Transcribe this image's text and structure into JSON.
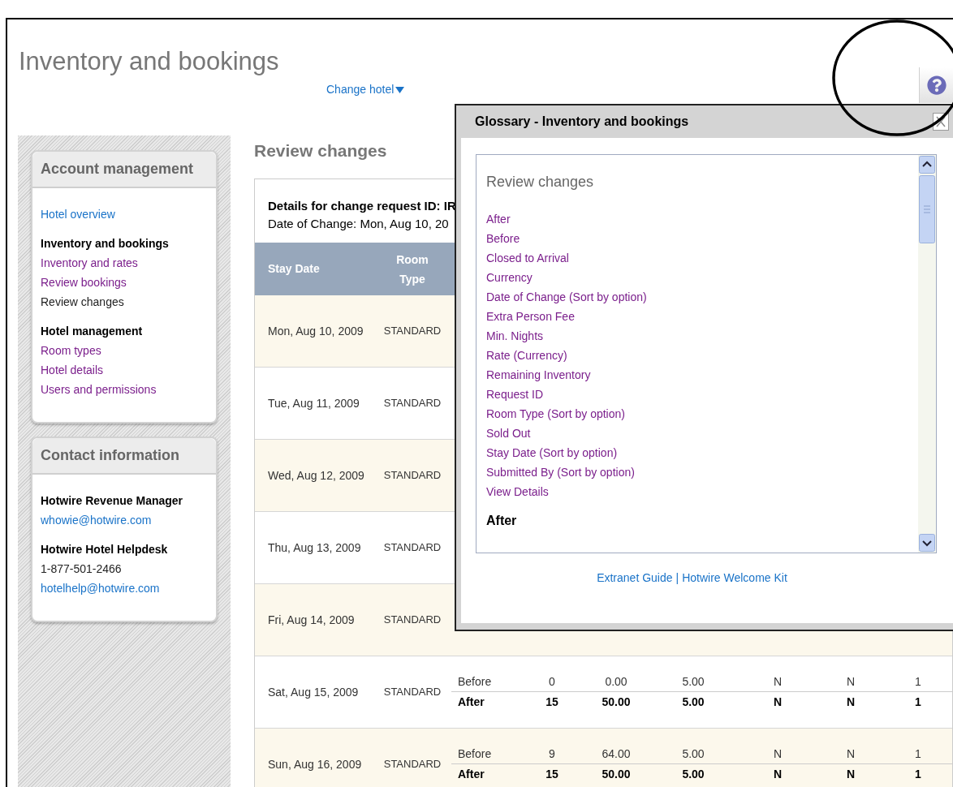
{
  "page_title": "Inventory and bookings",
  "change_hotel": "Change hotel",
  "sidebar": {
    "cards": [
      {
        "title": "Account management",
        "items": [
          {
            "label": "Hotel overview",
            "kind": "link"
          },
          {
            "label": "Inventory and bookings",
            "kind": "heading"
          },
          {
            "label": "Inventory and rates",
            "kind": "visited"
          },
          {
            "label": "Review bookings",
            "kind": "visited"
          },
          {
            "label": "Review changes",
            "kind": "current"
          },
          {
            "label": "Hotel management",
            "kind": "heading"
          },
          {
            "label": "Room types",
            "kind": "visited"
          },
          {
            "label": "Hotel details",
            "kind": "visited"
          },
          {
            "label": "Users and permissions",
            "kind": "visited"
          }
        ]
      },
      {
        "title": "Contact information",
        "items": [
          {
            "label": "Hotwire Revenue Manager",
            "kind": "heading"
          },
          {
            "label": "whowie@hotwire.com",
            "kind": "link"
          },
          {
            "label": "Hotwire Hotel Helpdesk",
            "kind": "heading"
          },
          {
            "label": "1-877-501-2466",
            "kind": "current"
          },
          {
            "label": "hotelhelp@hotwire.com",
            "kind": "link"
          }
        ]
      }
    ]
  },
  "main": {
    "heading": "Review changes",
    "details_title": "Details for change request ID: IR",
    "date_of_change": "Date of Change: Mon, Aug 10, 20",
    "table": {
      "columns": [
        "Stay Date",
        "Room Type"
      ],
      "rows": [
        {
          "stay_date": "Mon, Aug 10, 2009",
          "room_type": "STANDARD",
          "changes": []
        },
        {
          "stay_date": "Tue, Aug 11, 2009",
          "room_type": "STANDARD",
          "changes": []
        },
        {
          "stay_date": "Wed, Aug 12, 2009",
          "room_type": "STANDARD",
          "changes": []
        },
        {
          "stay_date": "Thu, Aug 13, 2009",
          "room_type": "STANDARD",
          "changes": []
        },
        {
          "stay_date": "Fri, Aug 14, 2009",
          "room_type": "STANDARD",
          "changes": []
        },
        {
          "stay_date": "Sat, Aug 15, 2009",
          "room_type": "STANDARD",
          "changes": [
            {
              "kind": "before",
              "label": "Before",
              "values": [
                "0",
                "0.00",
                "5.00",
                "N",
                "N",
                "1"
              ]
            },
            {
              "kind": "after",
              "label": "After",
              "values": [
                "15",
                "50.00",
                "5.00",
                "N",
                "N",
                "1"
              ]
            }
          ]
        },
        {
          "stay_date": "Sun, Aug 16, 2009",
          "room_type": "STANDARD",
          "changes": [
            {
              "kind": "before",
              "label": "Before",
              "values": [
                "9",
                "64.00",
                "5.00",
                "N",
                "N",
                "1"
              ]
            },
            {
              "kind": "after",
              "label": "After",
              "values": [
                "15",
                "50.00",
                "5.00",
                "N",
                "N",
                "1"
              ]
            }
          ]
        }
      ]
    }
  },
  "glossary": {
    "title": "Glossary - Inventory and bookings",
    "section": "Review changes",
    "terms": [
      "After",
      "Before",
      "Closed to Arrival",
      "Currency",
      "Date of Change (Sort by option)",
      "Extra Person Fee",
      "Min. Nights",
      "Rate (Currency)",
      "Remaining Inventory",
      "Request ID",
      "Room Type (Sort by option)",
      "Sold Out",
      "Stay Date (Sort by option)",
      "Submitted By (Sort by option)",
      "View Details"
    ],
    "definition_heading": "After",
    "links": [
      "Extranet Guide",
      "Hotwire Welcome Kit"
    ],
    "link_separator": "|"
  }
}
